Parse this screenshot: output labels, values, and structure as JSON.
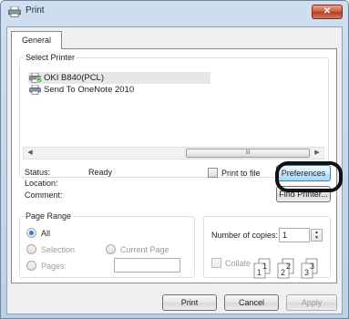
{
  "window": {
    "title": "Print",
    "close_label": "✕"
  },
  "tabs": [
    {
      "label": "General"
    }
  ],
  "select_printer": {
    "label": "Select Printer",
    "printers": [
      {
        "name": "OKI B840(PCL)",
        "selected": true
      },
      {
        "name": "Send To OneNote 2010",
        "selected": false
      }
    ],
    "scroll_thumb_glyph": "III"
  },
  "status": {
    "status_label": "Status:",
    "status_value": "Ready",
    "location_label": "Location:",
    "comment_label": "Comment:",
    "print_to_file_label": "Print to file",
    "preferences_label": "Preferences",
    "find_printer_label": "Find Printer..."
  },
  "page_range": {
    "label": "Page Range",
    "all_label": "All",
    "selection_label": "Selection",
    "current_page_label": "Current Page",
    "pages_label": "Pages:",
    "pages_value": ""
  },
  "copies": {
    "label": "Number of copies:",
    "value": "1",
    "collate_label": "Collate",
    "collate_pages": [
      "1",
      "1",
      "2",
      "2",
      "3",
      "3"
    ]
  },
  "footer": {
    "print_label": "Print",
    "cancel_label": "Cancel",
    "apply_label": "Apply"
  }
}
